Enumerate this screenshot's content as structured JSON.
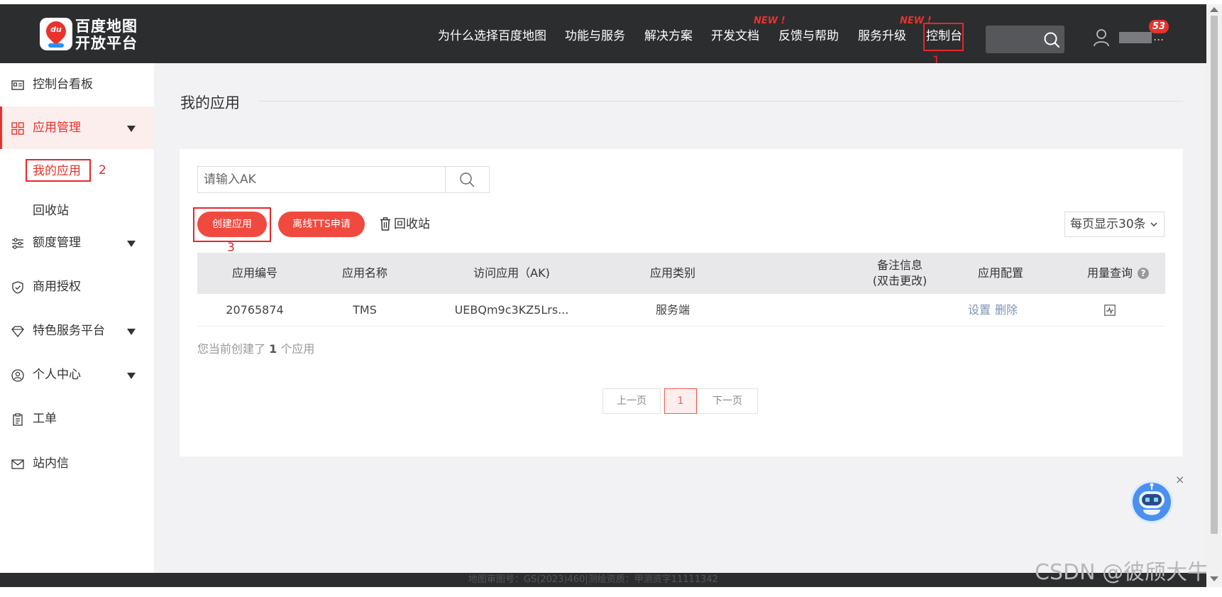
{
  "logo": {
    "pin_text": "du",
    "line1": "百度地图",
    "line2": "开放平台"
  },
  "nav": {
    "items": [
      "为什么选择百度地图",
      "功能与服务",
      "解决方案",
      "开发文档",
      "反馈与帮助",
      "服务升级",
      "控制台"
    ],
    "new_tag": "NEW !",
    "new_tag_2": "NEW !",
    "message_count": "53",
    "user_name": "..."
  },
  "annotations": {
    "n1": "1",
    "n2": "2",
    "n3": "3"
  },
  "sidebar": {
    "dashboard": "控制台看板",
    "app_manage": "应用管理",
    "my_apps": "我的应用",
    "recycle": "回收站",
    "quota": "额度管理",
    "license": "商用授权",
    "special": "特色服务平台",
    "personal": "个人中心",
    "ticket": "工单",
    "inbox": "站内信"
  },
  "main": {
    "title": "我的应用",
    "search_placeholder": "请输入AK",
    "create_button": "创建应用",
    "tts_button": "离线TTS申请",
    "recycle_link": "回收站",
    "page_size": "每页显示30条"
  },
  "table": {
    "headers": {
      "id": "应用编号",
      "name": "应用名称",
      "ak": "访问应用（AK)",
      "type": "应用类别",
      "note_line1": "备注信息",
      "note_line2": "(双击更改)",
      "config": "应用配置",
      "usage": "用量查询"
    },
    "rows": [
      {
        "id": "20765874",
        "name": "TMS",
        "ak": "UEBQm9c3KZ5Lrs...",
        "type": "服务端",
        "note": "",
        "config_set": "设置",
        "config_delete": "删除"
      }
    ]
  },
  "summary": {
    "prefix": "您当前创建了 ",
    "count": "1",
    "suffix": " 个应用"
  },
  "pagination": {
    "prev": "上一页",
    "current": "1",
    "next": "下一页"
  },
  "footer": {
    "text": "地图审图号：GS(2023)460|测绘资质：甲测资字11111342"
  },
  "watermark": "CSDN @彼颀大牛",
  "colors": {
    "accent": "#e8322c",
    "nav_bg": "#2c2d2f",
    "link": "#7d93b5"
  }
}
